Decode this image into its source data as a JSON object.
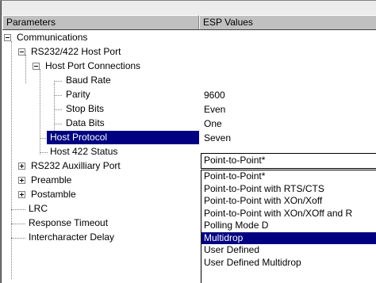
{
  "header": {
    "col_parameters": "Parameters",
    "col_values": "ESP Values"
  },
  "tree": {
    "communications": "Communications",
    "rs232_422_host_port": "RS232/422 Host Port",
    "host_port_connections": "Host Port Connections",
    "baud_rate": "Baud Rate",
    "parity": "Parity",
    "stop_bits": "Stop Bits",
    "data_bits": "Data Bits",
    "host_protocol": "Host Protocol",
    "host_422_status": "Host 422 Status",
    "rs232_aux_port": "RS232 Auxilliary Port",
    "preamble": "Preamble",
    "postamble": "Postamble",
    "lrc": "LRC",
    "response_timeout": "Response Timeout",
    "intercharacter_delay": "Intercharacter Delay"
  },
  "values": {
    "baud_rate": "9600",
    "parity": "Even",
    "stop_bits": "One",
    "data_bits": "Seven"
  },
  "host_protocol_combo": {
    "selected": "Point-to-Point*",
    "highlighted": "Multidrop",
    "options": [
      "Point-to-Point*",
      "Point-to-Point with RTS/CTS",
      "Point-to-Point with XOn/Xoff",
      "Point-to-Point with XOn/XOff and R",
      "Polling Mode D",
      "Multidrop",
      "User Defined",
      "User Defined Multidrop"
    ]
  },
  "icons": {
    "expanded": "minus-box-icon",
    "collapsed": "plus-box-icon"
  },
  "colors": {
    "selection": "#000080",
    "header": "#c0c0c0"
  }
}
